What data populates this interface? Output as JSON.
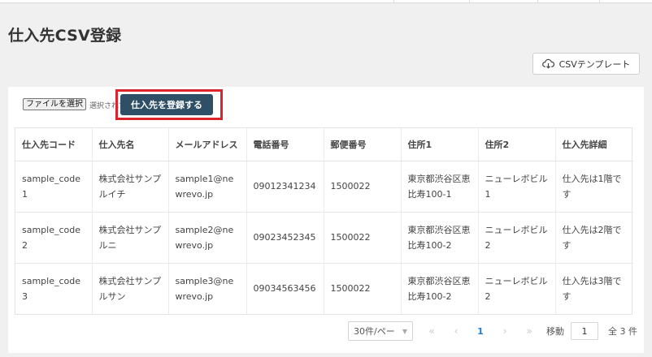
{
  "page": {
    "title": "仕入先CSV登録",
    "template_button_label": "CSVテンプレート"
  },
  "upload": {
    "file_button_label": "ファイルを選択",
    "file_status": "選択されていません",
    "register_button_label": "仕入先を登録する"
  },
  "table": {
    "headers": [
      "仕入先コード",
      "仕入先名",
      "メールアドレス",
      "電話番号",
      "郵便番号",
      "住所1",
      "住所2",
      "仕入先詳細"
    ],
    "rows": [
      [
        "sample_code1",
        "株式会社サンプルイチ",
        "sample1@newrevo.jp",
        "09012341234",
        "1500022",
        "東京都渋谷区恵比寿100-1",
        "ニューレボビル1",
        "仕入先は1階です"
      ],
      [
        "sample_code2",
        "株式会社サンプルニ",
        "sample2@newrevo.jp",
        "09023452345",
        "1500022",
        "東京都渋谷区恵比寿100-2",
        "ニューレボビル2",
        "仕入先は2階です"
      ],
      [
        "sample_code3",
        "株式会社サンプルサン",
        "sample3@newrevo.jp",
        "09034563456",
        "1500022",
        "東京都渋谷区恵比寿100-2",
        "ニューレボビル2",
        "仕入先は3階です"
      ]
    ]
  },
  "pagination": {
    "page_size_label": "30件/ペー",
    "first_icon": "«",
    "prev_icon": "‹",
    "current_page": "1",
    "next_icon": "›",
    "last_icon": "»",
    "jump_label": "移動",
    "jump_value": "1",
    "total_label": "全 3 件"
  },
  "colors": {
    "primary_button": "#2f4f66",
    "highlight_border": "#d9252b",
    "active_page": "#1d7ed6"
  }
}
